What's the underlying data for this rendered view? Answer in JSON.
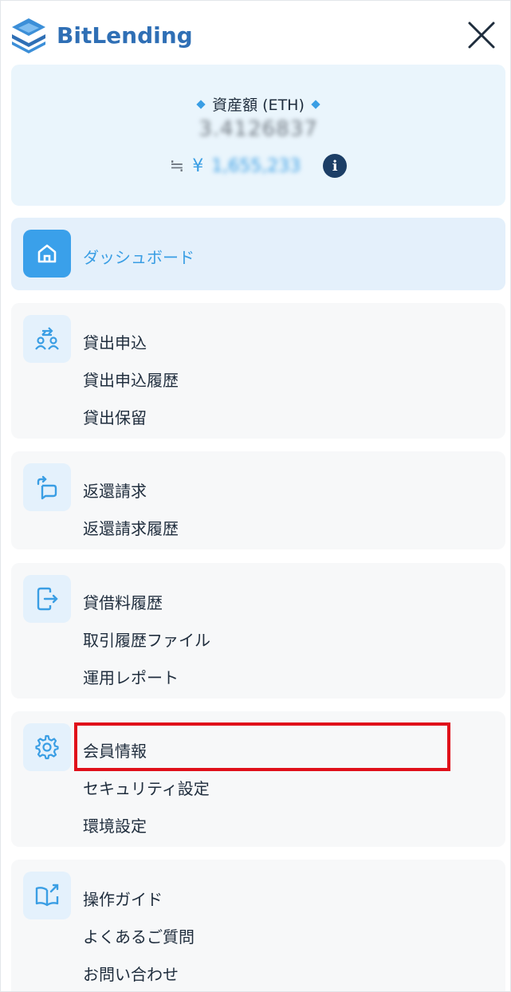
{
  "header": {
    "logo_text": "BitLending"
  },
  "assets": {
    "title": "資産額 (ETH)",
    "amount": "3.4126837",
    "approx_symbol": "≒",
    "yen_symbol": "¥",
    "jpy_value": "1,655,233"
  },
  "menu": {
    "dashboard": {
      "label": "ダッシュボード"
    },
    "lending": {
      "items": [
        "貸出申込",
        "貸出申込履歴",
        "貸出保留"
      ]
    },
    "return": {
      "items": [
        "返還請求",
        "返還請求履歴"
      ]
    },
    "history": {
      "items": [
        "貸借料履歴",
        "取引履歴ファイル",
        "運用レポート"
      ]
    },
    "settings": {
      "items": [
        "会員情報",
        "セキュリティ設定",
        "環境設定"
      ]
    },
    "help": {
      "items": [
        "操作ガイド",
        "よくあるご質問",
        "お問い合わせ"
      ]
    }
  },
  "colors": {
    "brand": "#2f6fb5",
    "accent": "#3a9ee4",
    "highlight": "#e0101a",
    "info": "#1c3e66"
  },
  "icons": {
    "logo": "layers-logo-icon",
    "close": "close-icon",
    "info": "info-icon",
    "dashboard": "home-icon",
    "lending": "people-exchange-icon",
    "return": "return-icon",
    "history": "file-export-icon",
    "settings": "gear-icon",
    "help": "book-icon"
  }
}
